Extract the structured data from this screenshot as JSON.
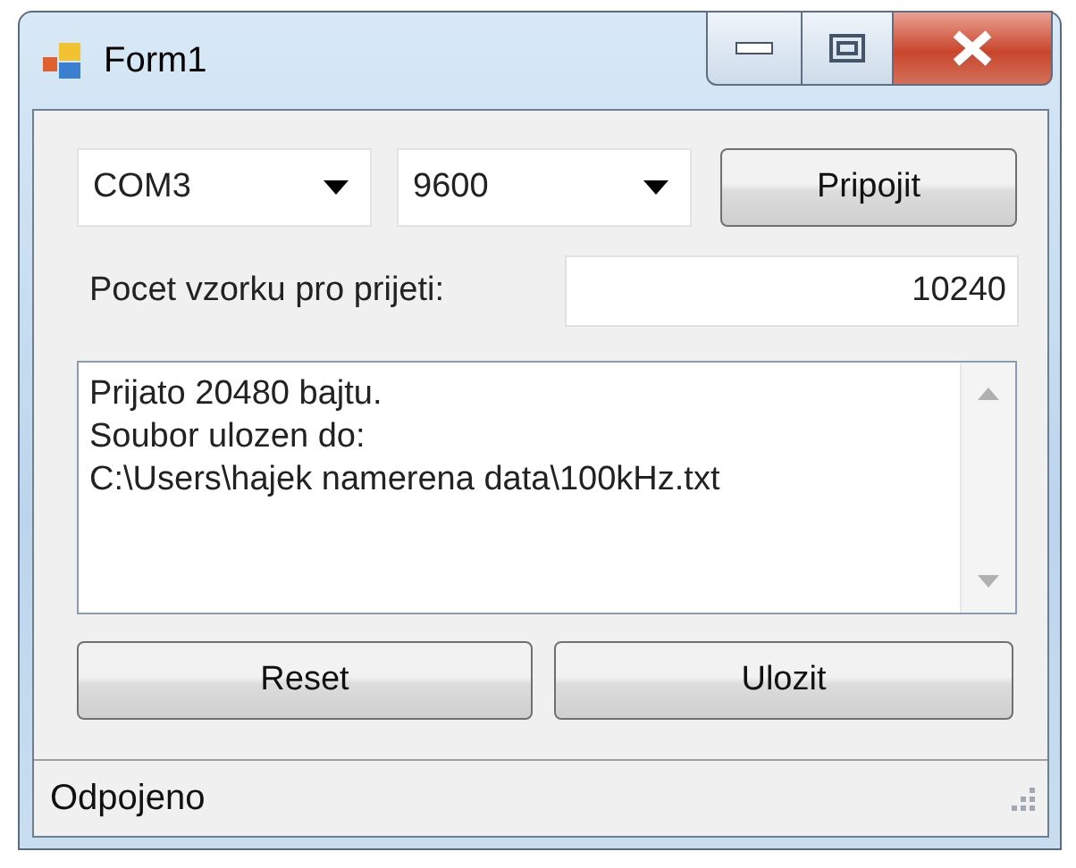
{
  "window": {
    "title": "Form1"
  },
  "port": {
    "value": "COM3"
  },
  "baud": {
    "value": "9600"
  },
  "connect_button": "Pripojit",
  "samples": {
    "label": "Pocet vzorku pro prijeti:",
    "value": "10240"
  },
  "log": {
    "lines": [
      "Prijato 20480 bajtu.",
      "Soubor ulozen do:",
      "C:\\Users\\hajek namerena data\\100kHz.txt"
    ]
  },
  "buttons": [
    "Reset",
    "Ulozit"
  ],
  "status_bar": "Odpojeno"
}
